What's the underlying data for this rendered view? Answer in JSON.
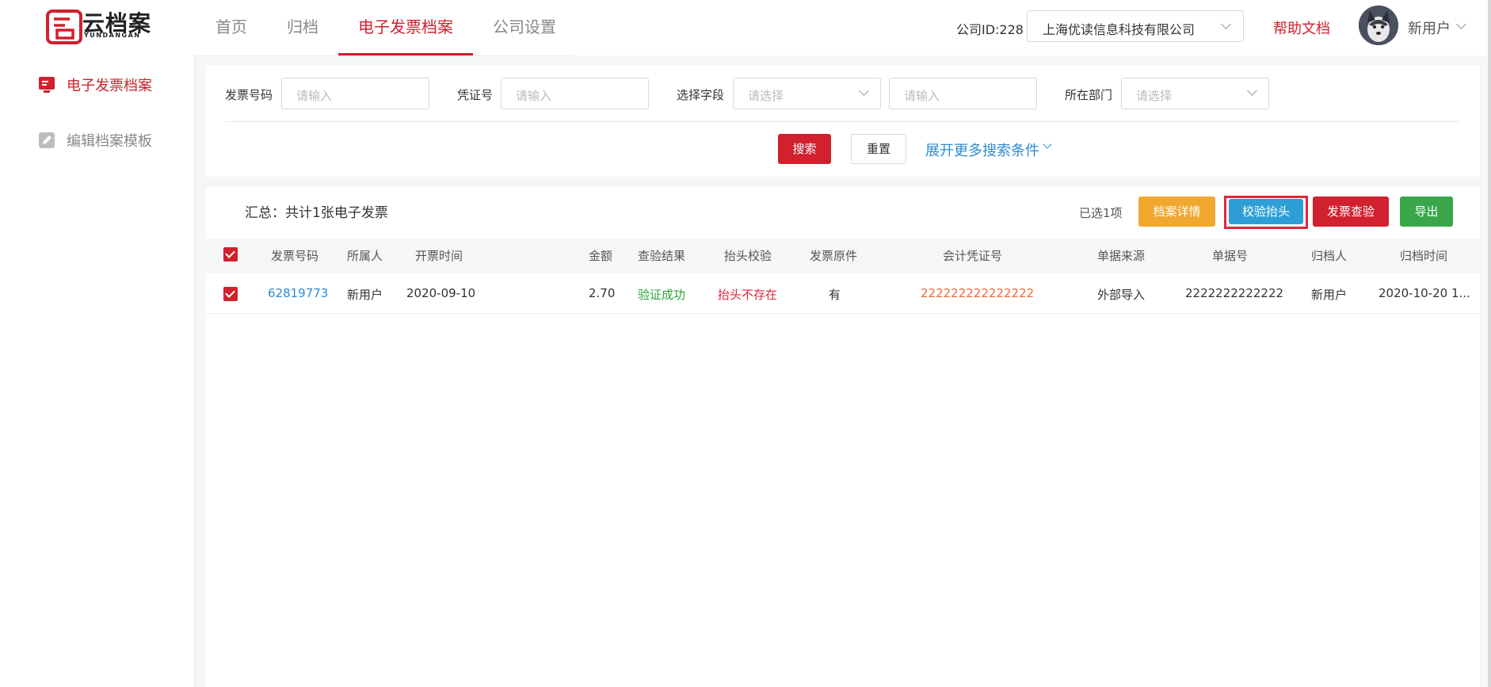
{
  "app": {
    "logo_text": "云档案",
    "logo_sub": "YUNDANGAN"
  },
  "nav": {
    "tabs": [
      "首页",
      "归档",
      "电子发票档案",
      "公司设置"
    ],
    "active_index": 2
  },
  "header": {
    "company_id_label": "公司ID:228",
    "company_name": "上海优读信息科技有限公司",
    "help_label": "帮助文档",
    "username": "新用户"
  },
  "sidebar": {
    "items": [
      {
        "label": "电子发票档案",
        "icon": "invoice-archive-icon",
        "active": true
      },
      {
        "label": "编辑档案模板",
        "icon": "edit-template-icon",
        "active": false
      }
    ]
  },
  "filters": {
    "invoice_no_label": "发票号码",
    "invoice_no_placeholder": "请输入",
    "voucher_label": "凭证号",
    "voucher_placeholder": "请输入",
    "field_label": "选择字段",
    "field_placeholder": "请选择",
    "field_value_placeholder": "请输入",
    "dept_label": "所在部门",
    "dept_placeholder": "请选择",
    "search_label": "搜索",
    "reset_label": "重置",
    "more_label": "展开更多搜索条件"
  },
  "toolbar": {
    "summary": "汇总：共计1张电子发票",
    "selected": "已选1项",
    "detail_label": "档案详情",
    "verify_title_label": "校验抬头",
    "check_label": "发票查验",
    "export_label": "导出"
  },
  "colors": {
    "brand": "#d1202e",
    "link": "#2d8cd3",
    "success": "#2aa43a",
    "warn": "#ee6a3b",
    "detail": "#f0a830",
    "verify": "#2d9fd6",
    "export": "#3aa64b"
  },
  "table": {
    "headers": [
      "发票号码",
      "所属人",
      "开票时间",
      "金额",
      "查验结果",
      "抬头校验",
      "发票原件",
      "会计凭证号",
      "单据来源",
      "单据号",
      "归档人",
      "归档时间"
    ],
    "rows": [
      [
        "62819773",
        "新用户",
        "2020-09-10",
        "2.70",
        "验证成功",
        "抬头不存在",
        "有",
        "222222222222222",
        "外部导入",
        "2222222222222",
        "新用户",
        "2020-10-20 1..."
      ]
    ]
  }
}
